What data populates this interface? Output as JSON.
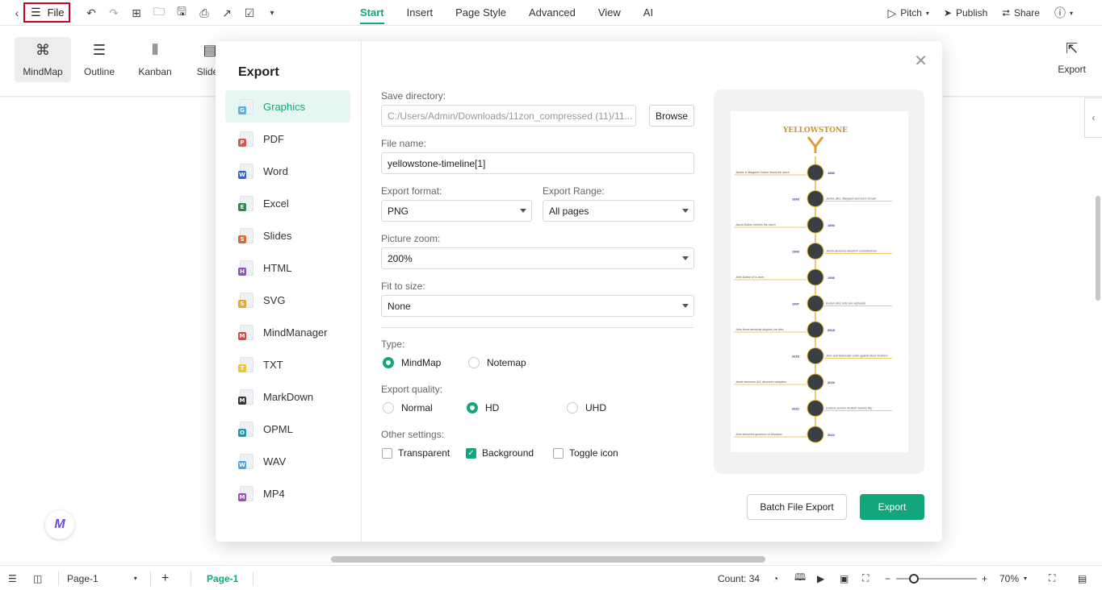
{
  "topbar": {
    "file_label": "File",
    "menu": [
      "Start",
      "Insert",
      "Page Style",
      "Advanced",
      "View",
      "AI"
    ],
    "active_menu": "Start",
    "pitch_label": "Pitch",
    "publish_label": "Publish",
    "share_label": "Share"
  },
  "ribbon": {
    "views": [
      "MindMap",
      "Outline",
      "Kanban",
      "Slides"
    ],
    "export_label": "Export"
  },
  "dialog": {
    "title": "Export",
    "formats": [
      {
        "label": "Graphics",
        "icon": "graphics-icon",
        "color": "#4fb3e8"
      },
      {
        "label": "PDF",
        "icon": "pdf-icon",
        "color": "#e5504b"
      },
      {
        "label": "Word",
        "icon": "word-icon",
        "color": "#2b66d0"
      },
      {
        "label": "Excel",
        "icon": "excel-icon",
        "color": "#1f8f4e"
      },
      {
        "label": "Slides",
        "icon": "slides-icon",
        "color": "#e0662e"
      },
      {
        "label": "HTML",
        "icon": "html-icon",
        "color": "#8f4fc8"
      },
      {
        "label": "SVG",
        "icon": "svg-icon",
        "color": "#e9a72b"
      },
      {
        "label": "MindManager",
        "icon": "mindmanager-icon",
        "color": "#d9473f"
      },
      {
        "label": "TXT",
        "icon": "txt-icon",
        "color": "#f1c232"
      },
      {
        "label": "MarkDown",
        "icon": "markdown-icon",
        "color": "#333333"
      },
      {
        "label": "OPML",
        "icon": "opml-icon",
        "color": "#1b9ab8"
      },
      {
        "label": "WAV",
        "icon": "wav-icon",
        "color": "#43a5e8"
      },
      {
        "label": "MP4",
        "icon": "mp4-icon",
        "color": "#a24bc6"
      }
    ],
    "active_format": "Graphics",
    "save_directory_label": "Save directory:",
    "save_directory_value": "C:/Users/Admin/Downloads/11zon_compressed (11)/11...",
    "browse_label": "Browse",
    "file_name_label": "File name:",
    "file_name_value": "yellowstone-timeline[1]",
    "export_format_label": "Export format:",
    "export_format_value": "PNG",
    "export_range_label": "Export Range:",
    "export_range_value": "All pages",
    "picture_zoom_label": "Picture zoom:",
    "picture_zoom_value": "200%",
    "fit_to_size_label": "Fit to size:",
    "fit_to_size_value": "None",
    "type_label": "Type:",
    "type_options": [
      "MindMap",
      "Notemap"
    ],
    "type_selected": "MindMap",
    "quality_label": "Export quality:",
    "quality_options": [
      "Normal",
      "HD",
      "UHD"
    ],
    "quality_selected": "HD",
    "other_label": "Other settings:",
    "other_options": [
      {
        "label": "Transparent",
        "checked": false
      },
      {
        "label": "Background",
        "checked": true
      },
      {
        "label": "Toggle icon",
        "checked": false
      }
    ],
    "batch_button": "Batch File Export",
    "export_button": "Export",
    "preview": {
      "title": "YELLOWSTONE",
      "events": [
        {
          "year": "1883",
          "text": "James & Margaret Dutton found the ranch"
        },
        {
          "year": "1893",
          "text": "James dies, Margaret and sons remain"
        },
        {
          "year": "1894",
          "text": "Jacob Dutton inherits the ranch"
        },
        {
          "year": "1903",
          "text": "Jacob becomes livestock commissioner"
        },
        {
          "year": "1936",
          "text": "John Dutton III is born"
        },
        {
          "year": "1997",
          "text": "Evelyn dies; kids are orphaned"
        },
        {
          "year": "2018",
          "text": "John faces territorial dispute Lee dies"
        },
        {
          "year": "2019",
          "text": "John and Rainwater unite against Beck brothers"
        },
        {
          "year": "2020",
          "text": "Jamie becomes AG; discovers adoption"
        },
        {
          "year": "2021",
          "text": "Duttons survive hit Beth marries Rip"
        },
        {
          "year": "2022",
          "text": "John becomes governor of Montana"
        }
      ]
    }
  },
  "statusbar": {
    "page_select": "Page-1",
    "page_tab": "Page-1",
    "count": "Count: 34",
    "zoom": "70%",
    "zoom_level": 0.7
  },
  "colors": {
    "accent": "#12a67c",
    "highlight_border": "#d0021b"
  }
}
